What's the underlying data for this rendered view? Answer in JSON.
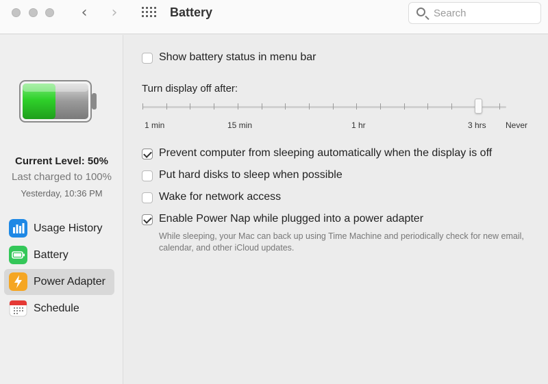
{
  "window": {
    "title": "Battery"
  },
  "search": {
    "placeholder": "Search"
  },
  "nav": {
    "back_icon": "chevron-left-icon",
    "forward_icon": "chevron-right-icon",
    "grid_icon": "grid-icon"
  },
  "battery_status": {
    "level_fraction": 0.5,
    "current_level": "Current Level: 50%",
    "last_charged": "Last charged to 100%",
    "timestamp": "Yesterday, 10:36 PM",
    "colors": {
      "fill": "#2fd12a",
      "empty": "#9a9a9a"
    }
  },
  "sidebar": {
    "items": [
      {
        "label": "Usage History",
        "icon": "bar-chart-icon",
        "color": "#1e88e5",
        "active": false
      },
      {
        "label": "Battery",
        "icon": "battery-icon",
        "color": "#34c759",
        "active": false
      },
      {
        "label": "Power Adapter",
        "icon": "lightning-icon",
        "color": "#f5a623",
        "active": true
      },
      {
        "label": "Schedule",
        "icon": "calendar-icon",
        "color": "#e53935",
        "active": false
      }
    ]
  },
  "settings": {
    "show_status": {
      "label": "Show battery status in menu bar",
      "checked": false
    },
    "turn_display_off": {
      "label": "Turn display off after:",
      "tick_labels": [
        "1 min",
        "15 min",
        "1 hr",
        "3 hrs",
        "Never"
      ],
      "value": "3 hrs"
    },
    "prevent_sleep": {
      "label": "Prevent computer from sleeping automatically when the display is off",
      "checked": true
    },
    "hard_disks": {
      "label": "Put hard disks to sleep when possible",
      "checked": false
    },
    "wake_network": {
      "label": "Wake for network access",
      "checked": false
    },
    "power_nap": {
      "label": "Enable Power Nap while plugged into a power adapter",
      "checked": true,
      "description": "While sleeping, your Mac can back up using Time Machine and periodically check for new email, calendar, and other iCloud updates."
    }
  }
}
